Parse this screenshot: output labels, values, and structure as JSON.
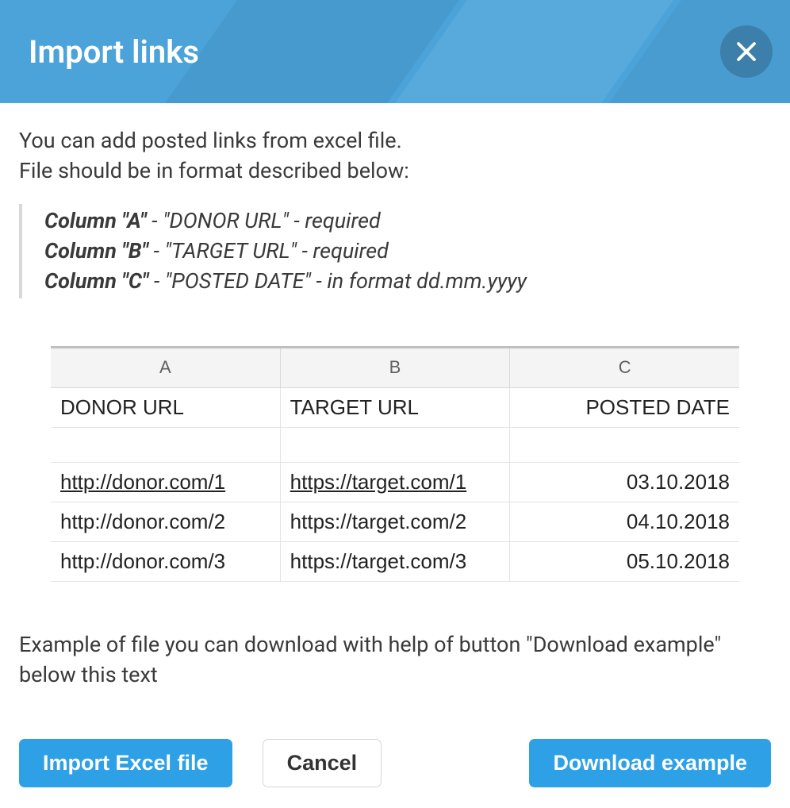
{
  "header": {
    "title": "Import links"
  },
  "body": {
    "intro_line1": "You can add posted links from excel file.",
    "intro_line2": "File should be in format described below:",
    "columns": [
      {
        "label": "Column \"A\"",
        "desc": " - \"DONOR URL\" - required"
      },
      {
        "label": "Column \"B\"",
        "desc": " - \"TARGET URL\" - required"
      },
      {
        "label": "Column \"C\"",
        "desc": " - \"POSTED DATE\" - in format dd.mm.yyyy"
      }
    ],
    "spreadsheet": {
      "col_letters": [
        "A",
        "B",
        "C"
      ],
      "header_row": [
        "DONOR URL",
        "TARGET URL",
        "POSTED DATE"
      ],
      "rows": [
        {
          "donor": "http://donor.com/1",
          "target": "https://target.com/1",
          "date": "03.10.2018",
          "underline": true
        },
        {
          "donor": "http://donor.com/2",
          "target": "https://target.com/2",
          "date": "04.10.2018",
          "underline": false
        },
        {
          "donor": "http://donor.com/3",
          "target": "https://target.com/3",
          "date": "05.10.2018",
          "underline": false
        }
      ]
    },
    "note": "Example of file you can download with help of button \"Download example\" below this text"
  },
  "footer": {
    "import_label": "Import Excel file",
    "cancel_label": "Cancel",
    "download_label": "Download example"
  }
}
